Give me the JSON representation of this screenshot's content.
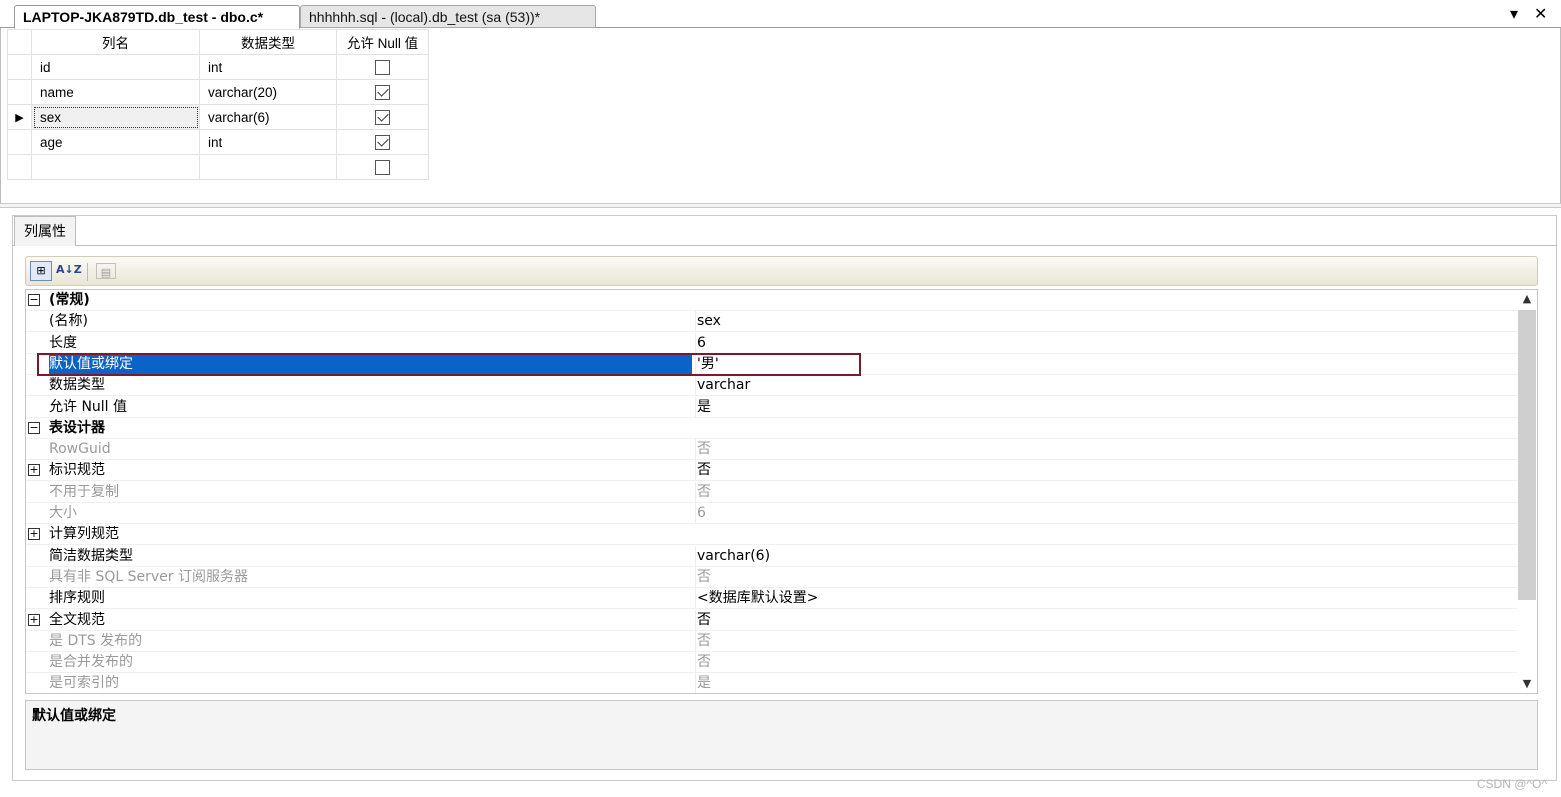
{
  "tabs": [
    {
      "label": "LAPTOP-JKA879TD.db_test - dbo.c*",
      "active": true
    },
    {
      "label": "hhhhhh.sql - (local).db_test (sa (53))*",
      "active": false
    }
  ],
  "tab_controls": {
    "dropdown": "▾",
    "close": "✕"
  },
  "grid": {
    "headers": [
      "列名",
      "数据类型",
      "允许 Null 值"
    ],
    "rows": [
      {
        "name": "id",
        "type": "int",
        "nullable": false,
        "current": false
      },
      {
        "name": "name",
        "type": "varchar(20)",
        "nullable": true,
        "current": false
      },
      {
        "name": "sex",
        "type": "varchar(6)",
        "nullable": true,
        "current": true
      },
      {
        "name": "age",
        "type": "int",
        "nullable": true,
        "current": false
      },
      {
        "name": "",
        "type": "",
        "nullable": false,
        "current": false
      }
    ]
  },
  "properties_tab": "列属性",
  "toolbar": {
    "categorized": "⊞",
    "alphabetical": "A↓Z",
    "pages": "▤"
  },
  "properties": [
    {
      "kind": "category",
      "expander": "⊟",
      "name": "(常规)",
      "value": ""
    },
    {
      "kind": "item",
      "name": "(名称)",
      "value": "sex"
    },
    {
      "kind": "item",
      "name": "长度",
      "value": "6"
    },
    {
      "kind": "item",
      "name": "默认值或绑定",
      "value": "'男'",
      "selected": true
    },
    {
      "kind": "item",
      "name": "数据类型",
      "value": "varchar"
    },
    {
      "kind": "item",
      "name": "允许 Null 值",
      "value": "是"
    },
    {
      "kind": "category",
      "expander": "⊟",
      "name": "表设计器",
      "value": ""
    },
    {
      "kind": "item",
      "name": "RowGuid",
      "value": "否",
      "dim": true
    },
    {
      "kind": "expandable",
      "expander": "⊞",
      "name": "标识规范",
      "value": "否"
    },
    {
      "kind": "item",
      "name": "不用于复制",
      "value": "否",
      "dim": true
    },
    {
      "kind": "item",
      "name": "大小",
      "value": "6",
      "dim": true
    },
    {
      "kind": "expandable",
      "expander": "⊞",
      "name": "计算列规范",
      "value": ""
    },
    {
      "kind": "item",
      "name": "简洁数据类型",
      "value": "varchar(6)"
    },
    {
      "kind": "item",
      "name": "具有非 SQL Server 订阅服务器",
      "value": "否",
      "dim": true
    },
    {
      "kind": "item",
      "name": "排序规则",
      "value": "<数据库默认设置>"
    },
    {
      "kind": "expandable",
      "expander": "⊞",
      "name": "全文规范",
      "value": "否"
    },
    {
      "kind": "item",
      "name": "是 DTS 发布的",
      "value": "否",
      "dim": true
    },
    {
      "kind": "item",
      "name": "是合并发布的",
      "value": "否",
      "dim": true
    },
    {
      "kind": "item",
      "name": "是可索引的",
      "value": "是",
      "dim": true
    }
  ],
  "scroll": {
    "up": "▲",
    "down": "▼"
  },
  "description": {
    "title": "默认值或绑定"
  },
  "watermark": "CSDN @^O^"
}
